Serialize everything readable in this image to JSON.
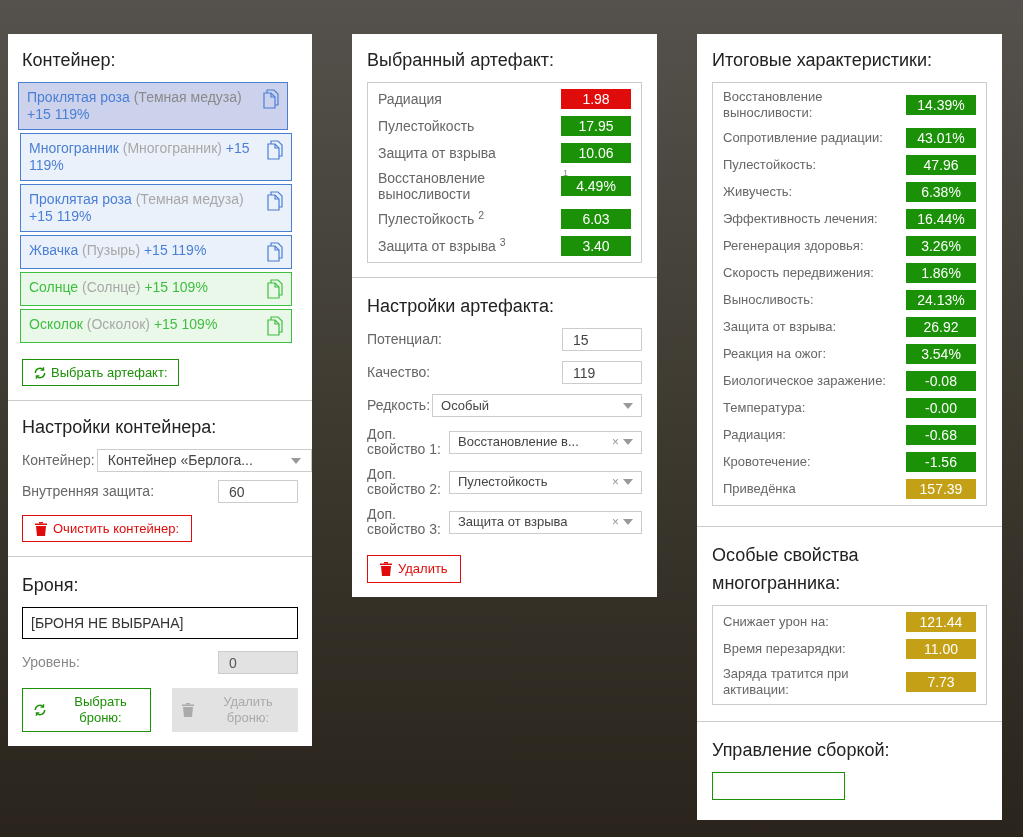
{
  "container": {
    "title": "Контейнер:",
    "items": [
      {
        "name": "Проклятая роза",
        "alias": "(Темная медуза)",
        "bonus": "+15 119%",
        "color": "#4a7fd6",
        "selected": true
      },
      {
        "name": "Многогранник",
        "alias": "(Многогранник)",
        "bonus": "+15 119%",
        "color": "#4a7fd6",
        "selected": false
      },
      {
        "name": "Проклятая роза",
        "alias": "(Темная медуза)",
        "bonus": "+15 119%",
        "color": "#4a7fd6",
        "selected": false
      },
      {
        "name": "Жвачка",
        "alias": "(Пузырь)",
        "bonus": "+15 119%",
        "color": "#4a7fd6",
        "selected": false
      },
      {
        "name": "Солнце",
        "alias": "(Солнце)",
        "bonus": "+15 109%",
        "color": "#3fbf3f",
        "selected": false
      },
      {
        "name": "Осколок",
        "alias": "(Осколок)",
        "bonus": "+15 109%",
        "color": "#3fbf3f",
        "selected": false
      }
    ],
    "pick_button": "Выбрать артефакт:"
  },
  "container_settings": {
    "title": "Настройки контейнера:",
    "container_label": "Контейнер:",
    "container_value": "Контейнер «Берлога...",
    "protection_label": "Внутренняя защита:",
    "protection_value": "60",
    "clear_button": "Очистить контейнер:"
  },
  "armor": {
    "title": "Броня:",
    "value": "[БРОНЯ НЕ ВЫБРАНА]",
    "level_label": "Уровень:",
    "level_value": "0",
    "pick_button": "Выбрать броню:",
    "remove_button": "Удалить броню:",
    "remove_disabled": true
  },
  "selected_artifact": {
    "title": "Выбранный артефакт:",
    "stats": [
      {
        "label": "Радиация",
        "value": "1.98",
        "color": "#e00b0b"
      },
      {
        "label": "Пулестойкость",
        "value": "17.95",
        "color": "#1a9106"
      },
      {
        "label": "Защита от взрыва",
        "value": "10.06",
        "color": "#1a9106"
      },
      {
        "label": "Восстановление выносливости",
        "value": "4.49%",
        "color": "#1a9106",
        "note": "1"
      },
      {
        "label": "Пулестойкость $^{2}$",
        "value": "6.03",
        "color": "#1a9106"
      },
      {
        "label": "Защита от взрыва $^{3}$",
        "value": "3.40",
        "color": "#1a9106"
      }
    ]
  },
  "artifact_settings": {
    "title": "Настройки артефакта:",
    "fields": [
      {
        "kind": "input",
        "label": "Потенциал:",
        "value": "15"
      },
      {
        "kind": "input",
        "label": "Качество:",
        "value": "119"
      },
      {
        "kind": "select",
        "label": "Редкость:",
        "value": "Особый"
      },
      {
        "kind": "select",
        "label": "Доп. свойство 1:",
        "value": "Восстановление в...",
        "clear": "×"
      },
      {
        "kind": "select",
        "label": "Доп. свойство 2:",
        "value": "Пулестойкость",
        "clear": "×"
      },
      {
        "kind": "select",
        "label": "Доп. свойство 3:",
        "value": "Защита от взрыва",
        "clear": "×"
      }
    ],
    "delete_button": "Удалить"
  },
  "totals": {
    "title": "Итоговые характеристики:",
    "stats": [
      {
        "label": "Восстановление выносливости:",
        "value": "14.39%",
        "color": "#1a9106"
      },
      {
        "label": "Сопротивление радиации:",
        "value": "43.01%",
        "color": "#1a9106"
      },
      {
        "label": "Пулестойкость:",
        "value": "47.96",
        "color": "#1a9106"
      },
      {
        "label": "Живучесть:",
        "value": "6.38%",
        "color": "#1a9106"
      },
      {
        "label": "Эффективность лечения:",
        "value": "16.44%",
        "color": "#1a9106"
      },
      {
        "label": "Регенерация здоровья:",
        "value": "3.26%",
        "color": "#1a9106"
      },
      {
        "label": "Скорость передвижения:",
        "value": "1.86%",
        "color": "#1a9106"
      },
      {
        "label": "Выносливость:",
        "value": "24.13%",
        "color": "#1a9106"
      },
      {
        "label": "Защита от взрыва:",
        "value": "26.92",
        "color": "#1a9106"
      },
      {
        "label": "Реакция на ожог:",
        "value": "3.54%",
        "color": "#1a9106"
      },
      {
        "label": "Биологическое заражение:",
        "value": "-0.08",
        "color": "#1a9106"
      },
      {
        "label": "Температура:",
        "value": "-0.00",
        "color": "#1a9106"
      },
      {
        "label": "Радиация:",
        "value": "-0.68",
        "color": "#1a9106"
      },
      {
        "label": "Кровотечение:",
        "value": "-1.56",
        "color": "#1a9106"
      },
      {
        "label": "Приведёнка",
        "value": "157.39",
        "color": "#c4a016"
      }
    ]
  },
  "special": {
    "title": "Особые свойства многогранника:",
    "stats": [
      {
        "label": "Снижает урон на:",
        "value": "121.44",
        "color": "#c4a016"
      },
      {
        "label": "Время перезарядки:",
        "value": "11.00",
        "color": "#c4a016"
      },
      {
        "label": "Заряда тратится при активации:",
        "value": "7.73",
        "color": "#c4a016"
      }
    ]
  },
  "build": {
    "title": "Управление сборкой:"
  }
}
